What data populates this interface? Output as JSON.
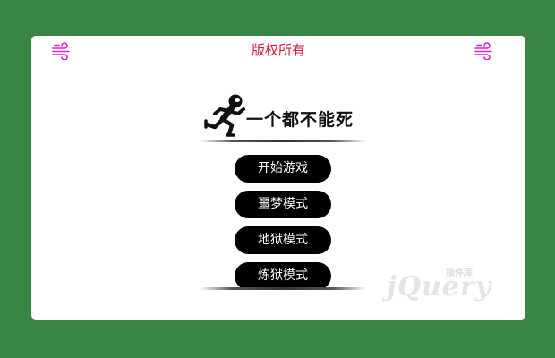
{
  "header": {
    "title": "版权所有",
    "left_icon": "wind-icon",
    "right_icon": "wind-icon"
  },
  "logo": {
    "title": "一个都不能死",
    "icon": "running-man-icon"
  },
  "menu": {
    "items": [
      {
        "label": "开始游戏"
      },
      {
        "label": "噩梦模式"
      },
      {
        "label": "地狱模式"
      },
      {
        "label": "炼狱模式"
      }
    ]
  },
  "watermark": {
    "main": "jQuery",
    "sub": "插件库"
  },
  "colors": {
    "background": "#3a8544",
    "header_title": "#d4143c",
    "icon": "#e020c8",
    "button": "#000000",
    "button_text": "#ffffff"
  }
}
